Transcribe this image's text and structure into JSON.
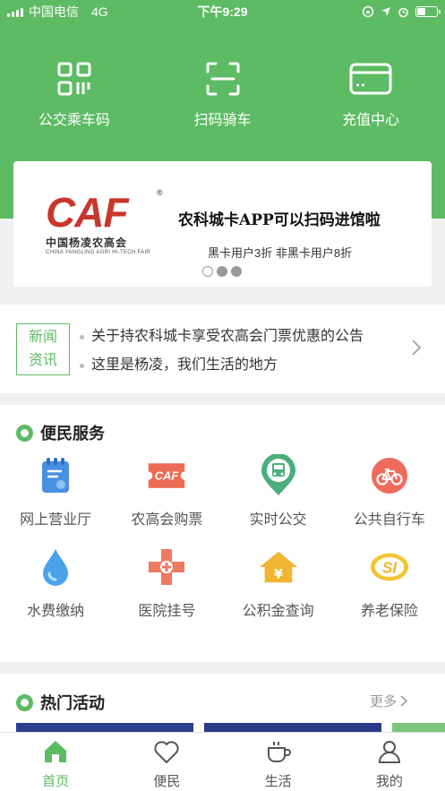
{
  "status_bar": {
    "carrier": "中国电信",
    "network": "4G",
    "time": "下午9:29"
  },
  "quick_actions": [
    {
      "label": "公交乘车码",
      "icon": "qr-code-icon"
    },
    {
      "label": "扫码骑车",
      "icon": "scan-icon"
    },
    {
      "label": "充值中心",
      "icon": "card-icon"
    }
  ],
  "banner": {
    "logo_text": "CAF",
    "logo_cn": "中国杨凌农高会",
    "logo_en": "CHINA YANGLING AGRI HI-TECH FAIR",
    "title": "农科城卡APP可以扫码进馆啦",
    "subtitle": "黑卡用户3折  非黑卡用户8折",
    "page_count": 3,
    "active_page": 1
  },
  "news": {
    "tag_line1": "新闻",
    "tag_line2": "资讯",
    "items": [
      "关于持农科城卡享受农高会门票优惠的公告",
      "这里是杨凌，我们生活的地方"
    ]
  },
  "services": {
    "title": "便民服务",
    "items": [
      {
        "label": "网上营业厅",
        "icon": "service-hall-icon",
        "color": "#4a90e2"
      },
      {
        "label": "农高会购票",
        "icon": "caf-ticket-icon",
        "color": "#e8674f"
      },
      {
        "label": "实时公交",
        "icon": "bus-icon",
        "color": "#4cae7a"
      },
      {
        "label": "公共自行车",
        "icon": "bicycle-icon",
        "color": "#ef6b5b"
      },
      {
        "label": "水费缴纳",
        "icon": "water-drop-icon",
        "color": "#4aa3e8"
      },
      {
        "label": "医院挂号",
        "icon": "hospital-icon",
        "color": "#ef7a62"
      },
      {
        "label": "公积金查询",
        "icon": "housing-fund-icon",
        "color": "#f2b531"
      },
      {
        "label": "养老保险",
        "icon": "pension-icon",
        "color": "#f2c431"
      }
    ]
  },
  "hot": {
    "title": "热门活动",
    "more_label": "更多"
  },
  "tabbar": [
    {
      "label": "首页",
      "icon": "home-icon",
      "active": true
    },
    {
      "label": "便民",
      "icon": "heart-icon",
      "active": false
    },
    {
      "label": "生活",
      "icon": "coffee-cup-icon",
      "active": false
    },
    {
      "label": "我的",
      "icon": "user-icon",
      "active": false
    }
  ],
  "colors": {
    "brand_green": "#5dbb63",
    "caf_red": "#c8372d"
  }
}
